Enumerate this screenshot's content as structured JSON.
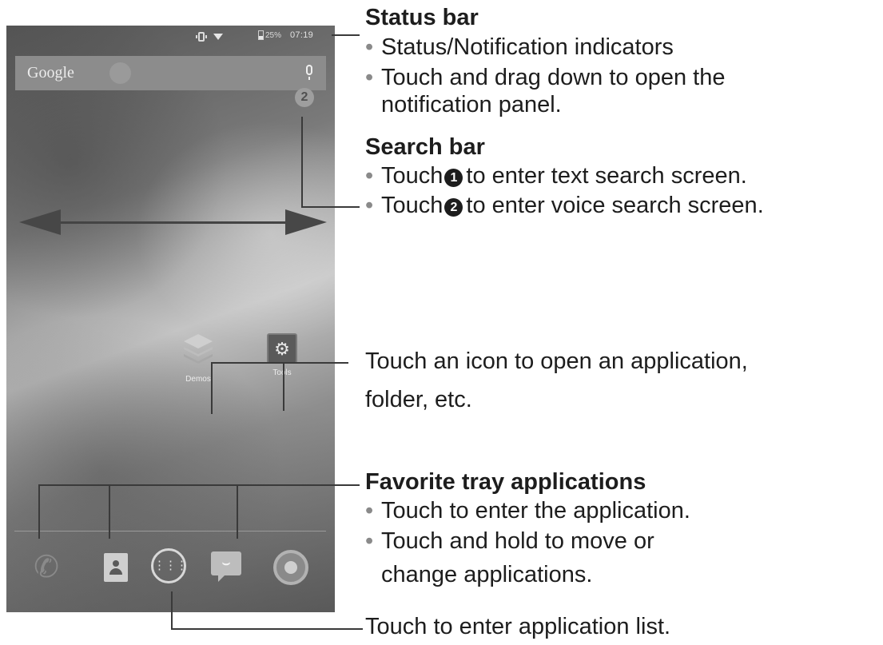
{
  "phone": {
    "status_bar": {
      "battery": "25%",
      "time": "07:19"
    },
    "search_bar": {
      "logo": "Google",
      "marker_2": "2"
    },
    "home_apps": [
      {
        "label": "Demos",
        "icon": "layers-icon"
      },
      {
        "label": "Tools",
        "icon": "tools-icon"
      }
    ],
    "favorite_tray": [
      "phone-icon",
      "contacts-icon",
      "app-list-icon",
      "messaging-icon",
      "browser-icon"
    ]
  },
  "annotations": {
    "status_bar": {
      "title": "Status bar",
      "bullets": [
        "Status/Notification indicators",
        "Touch and drag down to open the",
        "notification panel."
      ]
    },
    "search_bar": {
      "title": "Search bar",
      "bullet1_pre": "Touch",
      "bullet1_num": "1",
      "bullet1_post": "to enter text search screen.",
      "bullet2_pre": "Touch",
      "bullet2_num": "2",
      "bullet2_post": "to enter voice search screen."
    },
    "icon": {
      "line1": "Touch an icon to open an application,",
      "line2": "folder, etc."
    },
    "favorite_tray": {
      "title": "Favorite tray applications",
      "bullets": [
        "Touch to enter the application.",
        "Touch and hold to move or",
        "change applications."
      ]
    },
    "app_list": "Touch to enter application list."
  }
}
